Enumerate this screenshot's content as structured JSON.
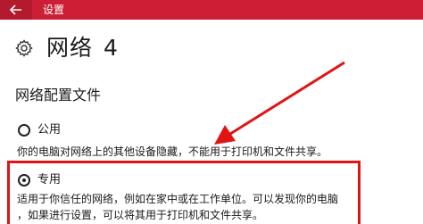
{
  "window": {
    "title": "设置"
  },
  "header": {
    "title": "网络",
    "number": "4"
  },
  "section": {
    "title": "网络配置文件"
  },
  "options": [
    {
      "label": "公用",
      "description": "你的电脑对网络上的其他设备隐藏，不能用于打印机和文件共享。",
      "selected": false
    },
    {
      "label": "专用",
      "description_line1": "适用于你信任的网络，例如在家中或在工作单位。可以发现你的电脑",
      "description_line2": "，如果进行设置，可以将其用于打印机和文件共享。",
      "selected": true
    }
  ],
  "icons": {
    "back": "back-arrow-icon",
    "settings": "gear-icon"
  },
  "colors": {
    "titlebar": "#cc1f36",
    "annotation": "#e01414"
  }
}
